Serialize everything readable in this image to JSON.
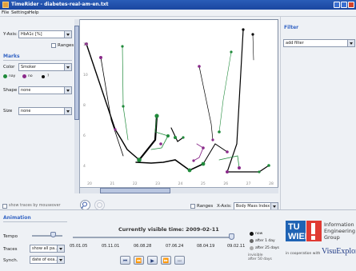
{
  "window": {
    "title": "TimeRider - diabetes-real-am-en.txt"
  },
  "menu": [
    "File",
    "Settings",
    "Help"
  ],
  "left": {
    "yaxis_label": "Y-Axis:",
    "yaxis_value": "HbA1c [%]",
    "ranges_label": "Ranges",
    "marks_title": "Marks",
    "color_label": "Color",
    "color_value": "Smoker",
    "legend": [
      {
        "label": "nay",
        "color": "#1f8a3a"
      },
      {
        "label": "no",
        "color": "#8a2a8a"
      },
      {
        "label": "?",
        "color": "#111111"
      }
    ],
    "shape_label": "Shape",
    "shape_value": "none",
    "size_label": "Size",
    "size_value": "none",
    "show_traces_label": "show traces by mouseover"
  },
  "plot_bottom": {
    "ranges_label": "Ranges",
    "xaxis_label": "X-Axis:",
    "xaxis_value": "Body Mass Index"
  },
  "right": {
    "filter_title": "Filter",
    "add_filter_value": "add filter"
  },
  "animation": {
    "title": "Animation",
    "tempo_label": "Tempo",
    "traces_label": "Traces",
    "traces_value": "show all pa...",
    "synch_label": "Synch.",
    "synch_value": "date of exa...",
    "visible_time": "Currently visible time: 2009-02-11",
    "dates": [
      "05.01.05",
      "05.11.01",
      "06.08.28",
      "07.06.24",
      "08.04.19",
      "09.02.11"
    ],
    "legend_now": "now",
    "legend_1day": "after 1 day",
    "legend_25days": "after 25 days",
    "legend_invisible": "invisible after 50 days",
    "tuwien": "TU WIEN",
    "group_line1": "Information",
    "group_line2": "Engineering",
    "group_line3": "Group",
    "cooperation": "in cooperation with",
    "visu_logo": "VisuExplore"
  },
  "chart_data": {
    "type": "scatter",
    "x_ticks": [
      "20",
      "21",
      "22",
      "23",
      "24",
      "25",
      "26",
      "27",
      "28"
    ],
    "y_ticks": [
      "4",
      "6",
      "8",
      "10",
      "12"
    ]
  }
}
